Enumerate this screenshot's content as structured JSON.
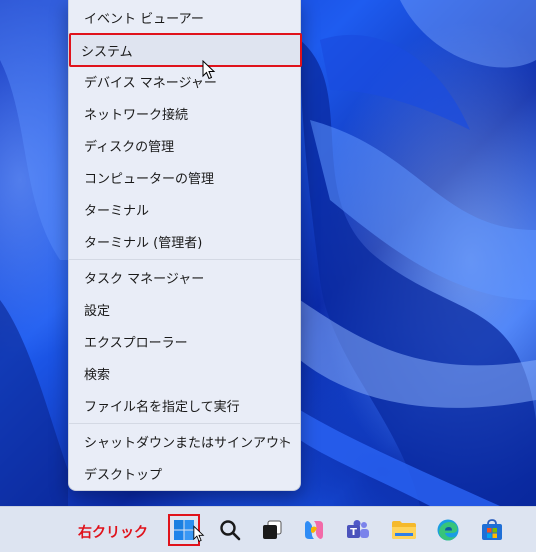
{
  "context_menu": {
    "items": [
      {
        "label": "イベント ビューアー"
      },
      {
        "label": "システム"
      },
      {
        "label": "デバイス マネージャー"
      },
      {
        "label": "ネットワーク接続"
      },
      {
        "label": "ディスクの管理"
      },
      {
        "label": "コンピューターの管理"
      },
      {
        "label": "ターミナル"
      },
      {
        "label": "ターミナル (管理者)"
      },
      {
        "label": "タスク マネージャー"
      },
      {
        "label": "設定"
      },
      {
        "label": "エクスプローラー"
      },
      {
        "label": "検索"
      },
      {
        "label": "ファイル名を指定して実行"
      },
      {
        "label": "シャットダウンまたはサインアウト",
        "submenu_arrow": "›"
      },
      {
        "label": "デスクトップ"
      }
    ],
    "highlighted_item": "システム"
  },
  "taskbar": {
    "annotation": "右クリック",
    "annotation_color": "#e0121b",
    "icons": [
      {
        "name": "start-icon"
      },
      {
        "name": "search-icon"
      },
      {
        "name": "task-view-icon"
      },
      {
        "name": "copilot-icon"
      },
      {
        "name": "teams-icon"
      },
      {
        "name": "file-explorer-icon"
      },
      {
        "name": "edge-icon"
      },
      {
        "name": "store-icon"
      }
    ]
  },
  "colors": {
    "highlight_border": "#e0121b",
    "menu_background": "#e9edf7",
    "taskbar_background": "#dde4f1",
    "wallpaper_blue": "#1e5cf0"
  }
}
